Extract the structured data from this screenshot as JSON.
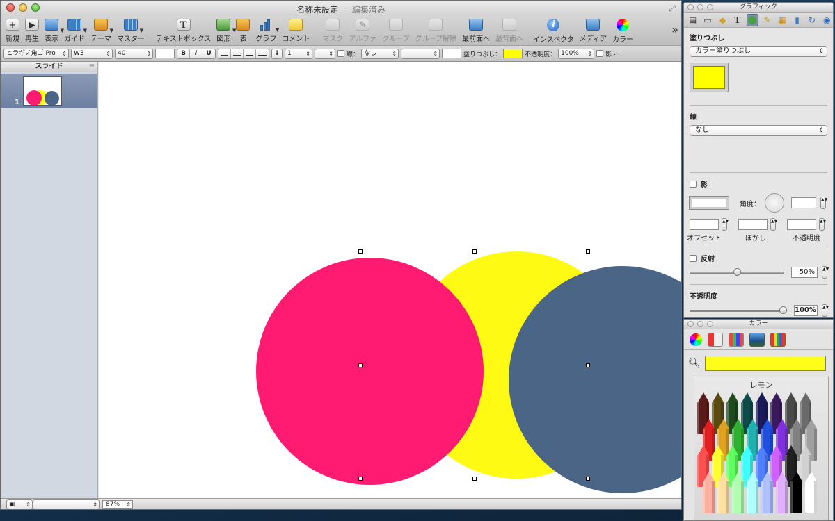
{
  "window": {
    "title": "名称未設定",
    "edited_suffix": " — 編集済み"
  },
  "toolbar": {
    "items": [
      {
        "label": "新規",
        "icon": "new-icon"
      },
      {
        "label": "再生",
        "icon": "play-icon"
      },
      {
        "label": "表示",
        "icon": "view-icon"
      },
      {
        "label": "ガイド",
        "icon": "guide-icon"
      },
      {
        "label": "テーマ",
        "icon": "theme-icon"
      },
      {
        "label": "マスター",
        "icon": "master-icon"
      },
      {
        "label": "テキストボックス",
        "icon": "textbox-icon",
        "glyph": "T"
      },
      {
        "label": "図形",
        "icon": "shapes-icon"
      },
      {
        "label": "表",
        "icon": "table-icon"
      },
      {
        "label": "グラフ",
        "icon": "chart-icon"
      },
      {
        "label": "コメント",
        "icon": "comment-icon"
      },
      {
        "label": "マスク",
        "icon": "mask-icon"
      },
      {
        "label": "アルファ",
        "icon": "alpha-icon"
      },
      {
        "label": "グループ",
        "icon": "group-icon"
      },
      {
        "label": "グループ解除",
        "icon": "ungroup-icon"
      },
      {
        "label": "最前面へ",
        "icon": "bring-front-icon"
      },
      {
        "label": "最背面へ",
        "icon": "send-back-icon"
      },
      {
        "label": "インスペクタ",
        "icon": "inspector-icon",
        "glyph": "i"
      },
      {
        "label": "メディア",
        "icon": "media-icon"
      },
      {
        "label": "カラー",
        "icon": "colors-icon"
      }
    ],
    "overflow": "»"
  },
  "format": {
    "font": "ヒラギノ角ゴ Pro",
    "weight": "W3",
    "size": "40",
    "bold": "B",
    "italic": "I",
    "underline": "U",
    "line_spacing": "1",
    "stroke_label": "線：",
    "stroke_value": "なし",
    "fill_label": "塗りつぶし：",
    "fill_color": "#ffff00",
    "opacity_label": "不透明度：",
    "opacity_value": "100%",
    "shadow_label": "影",
    "more": "..."
  },
  "sidebar": {
    "title": "スライド",
    "slide_number": "1"
  },
  "status": {
    "zoom": "87%"
  },
  "canvas": {
    "shapes": [
      {
        "name": "pink-circle",
        "color": "#ff1a72"
      },
      {
        "name": "yellow-circle",
        "color": "#fffa14"
      },
      {
        "name": "slate-circle",
        "color": "#4a6585"
      }
    ]
  },
  "inspector": {
    "title": "グラフィック",
    "fill": {
      "heading": "塗りつぶし",
      "type": "カラー塗りつぶし",
      "color": "#ffff00"
    },
    "stroke": {
      "heading": "線",
      "value": "なし"
    },
    "shadow": {
      "heading": "影",
      "angle_label": "角度：",
      "offset_label": "オフセット",
      "blur_label": "ぼかし",
      "opacity_label": "不透明度"
    },
    "reflection": {
      "heading": "反射",
      "value": "50%",
      "level": 0.5
    },
    "opacity": {
      "heading": "不透明度",
      "value": "100%",
      "level": 1.0
    }
  },
  "colors": {
    "title": "カラー",
    "current_color": "#ffff1a",
    "crayon_name": "レモン"
  }
}
